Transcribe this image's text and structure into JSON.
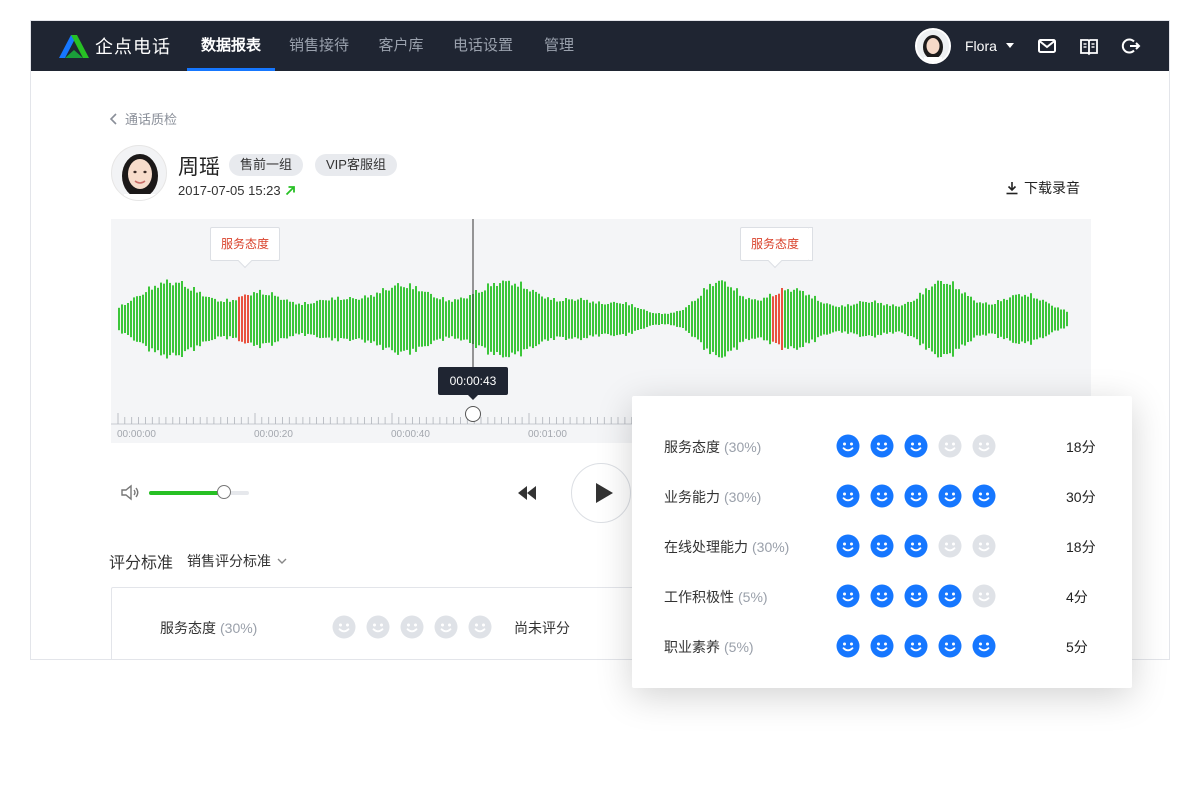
{
  "nav": {
    "brand": "企点电话",
    "tabs": [
      {
        "label": "数据报表",
        "active": true
      },
      {
        "label": "销售接待",
        "active": false
      },
      {
        "label": "客户库",
        "active": false
      },
      {
        "label": "电话设置",
        "active": false
      },
      {
        "label": "管理",
        "active": false
      }
    ],
    "user": "Flora",
    "icons": [
      "mail-icon",
      "book-icon",
      "logout-icon"
    ]
  },
  "breadcrumb": {
    "back_label": "通话质检"
  },
  "call": {
    "name": "周瑶",
    "tags": [
      "售前一组",
      "VIP客服组"
    ],
    "datetime": "2017-07-05 15:23",
    "download_label": "下载录音"
  },
  "player": {
    "markers": [
      "服务态度",
      "服务态度"
    ],
    "current_time": "00:00:43",
    "timeline_labels": [
      "00:00:00",
      "00:00:20",
      "00:00:40",
      "00:01:00"
    ],
    "volume_level": 0.75,
    "colors": {
      "wave": "#27c024",
      "highlight": "#e8402a",
      "accent": "#1677ff"
    }
  },
  "scoring": {
    "label": "评分标准",
    "standard": "销售评分标准",
    "visible_row": {
      "name": "服务态度",
      "weight": "(30%)",
      "status": "尚未评分"
    }
  },
  "popover": {
    "items": [
      {
        "name": "服务态度",
        "weight": "(30%)",
        "rating": 3,
        "score": "18分"
      },
      {
        "name": "业务能力",
        "weight": "(30%)",
        "rating": 5,
        "score": "30分"
      },
      {
        "name": "在线处理能力",
        "weight": "(30%)",
        "rating": 3,
        "score": "18分"
      },
      {
        "name": "工作积极性",
        "weight": "(5%)",
        "rating": 4,
        "score": "4分"
      },
      {
        "name": "职业素养",
        "weight": "(5%)",
        "rating": 5,
        "score": "5分"
      }
    ]
  }
}
